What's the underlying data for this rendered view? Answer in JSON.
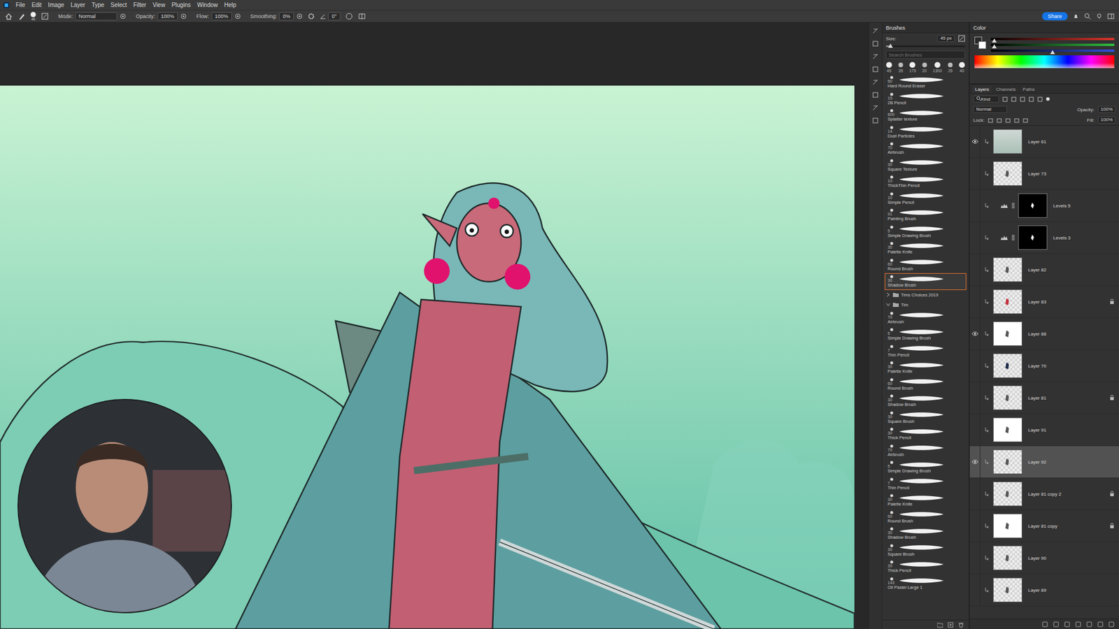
{
  "menu": [
    "File",
    "Edit",
    "Image",
    "Layer",
    "Type",
    "Select",
    "Filter",
    "View",
    "Plugins",
    "Window",
    "Help"
  ],
  "options": {
    "brush_size": "45",
    "groups": [
      {
        "label": "Mode:",
        "value": "Normal",
        "kind": "dropdown"
      },
      {
        "label": "Opacity:",
        "value": "100%",
        "kind": "field"
      },
      {
        "label": "Flow:",
        "value": "100%",
        "kind": "field"
      },
      {
        "label": "Smoothing:",
        "value": "0%",
        "kind": "field"
      }
    ],
    "angle": "0°"
  },
  "share": "Share",
  "brushes": {
    "title": "Brushes",
    "size_label": "Size:",
    "size": "45 px",
    "size_level": 0.06,
    "search_placeholder": "Search Brushes",
    "presets": [
      "45",
      "35",
      "175",
      "20",
      "1300",
      "25",
      "40"
    ],
    "items": [
      {
        "kind": "brush",
        "size": "50",
        "name": "Hard Round Eraser",
        "selected": false
      },
      {
        "kind": "brush",
        "size": "15",
        "name": "2B Pencil",
        "selected": false
      },
      {
        "kind": "brush",
        "size": "800",
        "name": "Splatter texture",
        "selected": false
      },
      {
        "kind": "brush",
        "size": "14",
        "name": "Dust Particles",
        "selected": false
      },
      {
        "kind": "brush",
        "size": "70",
        "name": "Airbrush",
        "selected": false
      },
      {
        "kind": "brush",
        "size": "30",
        "name": "Square Texture",
        "selected": false
      },
      {
        "kind": "brush",
        "size": "10",
        "name": "ThickThin Pencil",
        "selected": false
      },
      {
        "kind": "brush",
        "size": "10",
        "name": "Simple Pencil",
        "selected": false
      },
      {
        "kind": "brush",
        "size": "91",
        "name": "Painting Brush",
        "selected": false
      },
      {
        "kind": "brush",
        "size": "5",
        "name": "Simple Drawing Brush",
        "selected": false
      },
      {
        "kind": "brush",
        "size": "30",
        "name": "Palette Knife",
        "selected": false
      },
      {
        "kind": "brush",
        "size": "60",
        "name": "Round Brush",
        "selected": false
      },
      {
        "kind": "brush",
        "size": "30",
        "name": "Shadow Brush",
        "selected": true
      },
      {
        "kind": "group",
        "name": "Tims Choices 2019",
        "expanded": false,
        "selected": false
      },
      {
        "kind": "group",
        "name": "Tim",
        "expanded": true,
        "selected": false
      },
      {
        "kind": "brush",
        "size": "70",
        "name": "Airbrush",
        "selected": false
      },
      {
        "kind": "brush",
        "size": "5",
        "name": "Simple Drawing Brush",
        "selected": false
      },
      {
        "kind": "brush",
        "size": "7",
        "name": "Thin Pencil",
        "selected": false
      },
      {
        "kind": "brush",
        "size": "30",
        "name": "Palette Knife",
        "selected": false
      },
      {
        "kind": "brush",
        "size": "60",
        "name": "Round Brush",
        "selected": false
      },
      {
        "kind": "brush",
        "size": "30",
        "name": "Shadow Brush",
        "selected": false
      },
      {
        "kind": "brush",
        "size": "30",
        "name": "Square Brush",
        "selected": false
      },
      {
        "kind": "brush",
        "size": "30",
        "name": "Thick Pencil",
        "selected": false
      },
      {
        "kind": "brush",
        "size": "70",
        "name": "Airbrush",
        "selected": false
      },
      {
        "kind": "brush",
        "size": "5",
        "name": "Simple Drawing Brush",
        "selected": false
      },
      {
        "kind": "brush",
        "size": "7",
        "name": "Thin Pencil",
        "selected": false
      },
      {
        "kind": "brush",
        "size": "30",
        "name": "Palette Knife",
        "selected": false
      },
      {
        "kind": "brush",
        "size": "60",
        "name": "Round Brush",
        "selected": false
      },
      {
        "kind": "brush",
        "size": "30",
        "name": "Shadow Brush",
        "selected": false
      },
      {
        "kind": "brush",
        "size": "30",
        "name": "Square Brush",
        "selected": false
      },
      {
        "kind": "brush",
        "size": "30",
        "name": "Thick Pencil",
        "selected": false
      },
      {
        "kind": "brush",
        "size": "143",
        "name": "Oil Pastel Large 1",
        "selected": false
      }
    ]
  },
  "color": {
    "title": "Color",
    "sliders": [
      {
        "level": 0.03,
        "color": "#e0342a"
      },
      {
        "level": 0.03,
        "color": "#30c040"
      },
      {
        "level": 0.5,
        "color": "#3050e0"
      }
    ]
  },
  "layers": {
    "tabs": [
      {
        "label": "Layers",
        "selected": true
      },
      {
        "label": "Channels",
        "selected": false
      },
      {
        "label": "Paths",
        "selected": false
      }
    ],
    "filter": "Kind",
    "blend": "Normal",
    "opacity_label": "Opacity:",
    "opacity": "100%",
    "lock_label": "Lock:",
    "fill_label": "Fill:",
    "fill": "100%",
    "rows": [
      {
        "name": "Layer 61",
        "kind": "layer",
        "visible": true,
        "locked": false,
        "selected": false
      },
      {
        "name": "Layer 73",
        "kind": "layer",
        "visible": false,
        "locked": false,
        "selected": false
      },
      {
        "name": "Levels 5",
        "kind": "adjustment",
        "visible": false,
        "locked": false,
        "selected": false
      },
      {
        "name": "Levels 3",
        "kind": "adjustment",
        "visible": false,
        "locked": false,
        "selected": false
      },
      {
        "name": "Layer 82",
        "kind": "layer",
        "visible": false,
        "locked": false,
        "selected": false
      },
      {
        "name": "Layer 83",
        "kind": "layer",
        "visible": false,
        "locked": true,
        "selected": false
      },
      {
        "name": "Layer 88",
        "kind": "layer",
        "visible": true,
        "locked": false,
        "selected": false
      },
      {
        "name": "Layer 70",
        "kind": "layer",
        "visible": false,
        "locked": false,
        "selected": false
      },
      {
        "name": "Layer 81",
        "kind": "layer",
        "visible": false,
        "locked": true,
        "selected": false
      },
      {
        "name": "Layer 91",
        "kind": "layer",
        "visible": false,
        "locked": false,
        "selected": false
      },
      {
        "name": "Layer 92",
        "kind": "layer",
        "visible": true,
        "locked": false,
        "selected": true
      },
      {
        "name": "Layer 81 copy 2",
        "kind": "layer",
        "visible": false,
        "locked": true,
        "selected": false
      },
      {
        "name": "Layer 81 copy",
        "kind": "layer",
        "visible": false,
        "locked": true,
        "selected": false
      },
      {
        "name": "Layer 90",
        "kind": "layer",
        "visible": false,
        "locked": false,
        "selected": false
      },
      {
        "name": "Layer 89",
        "kind": "layer",
        "visible": false,
        "locked": false,
        "selected": false
      }
    ]
  }
}
